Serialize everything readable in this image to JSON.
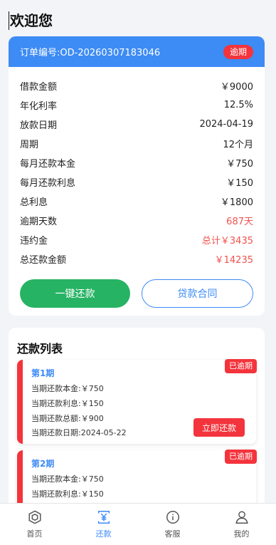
{
  "header": {
    "title": "欢迎您"
  },
  "order": {
    "order_no": "订单编号:OD-20260307183046",
    "status_badge": "逾期",
    "rows": [
      {
        "label": "借款金额",
        "value": "￥9000",
        "red": false
      },
      {
        "label": "年化利率",
        "value": "12.5%",
        "red": false
      },
      {
        "label": "放款日期",
        "value": "2024-04-19",
        "red": false
      },
      {
        "label": "周期",
        "value": "12个月",
        "red": false
      },
      {
        "label": "每月还款本金",
        "value": "￥750",
        "red": false
      },
      {
        "label": "每月还款利息",
        "value": "￥150",
        "red": false
      },
      {
        "label": "总利息",
        "value": "￥1800",
        "red": false
      },
      {
        "label": "逾期天数",
        "value": "687天",
        "red": true
      },
      {
        "label": "违约金",
        "value": "总计￥3435",
        "red": true
      },
      {
        "label": "总还款金额",
        "value": "￥14235",
        "red": true
      }
    ],
    "repay_button": "一键还款",
    "contract_button": "贷款合同"
  },
  "repayment_list": {
    "title": "还款列表",
    "items": [
      {
        "term": "第1期",
        "badge": "已逾期",
        "principal": "当期还款本金:￥750",
        "interest": "当期还款利息:￥150",
        "total": "当期还款总额:￥900",
        "date": "当期还款日期:2024-05-22",
        "pay_button": "立即还款"
      },
      {
        "term": "第2期",
        "badge": "已逾期",
        "principal": "当期还款本金:￥750",
        "interest": "当期还款利息:￥150"
      }
    ]
  },
  "tabbar": {
    "items": [
      {
        "label": "首页",
        "icon": "home-cube-icon",
        "active": false
      },
      {
        "label": "还款",
        "icon": "yen-icon",
        "active": true
      },
      {
        "label": "客服",
        "icon": "info-circle-icon",
        "active": false
      },
      {
        "label": "我的",
        "icon": "user-icon",
        "active": false
      }
    ]
  },
  "colors": {
    "primary": "#3d8bf5",
    "danger": "#f3343c",
    "success": "#27b364"
  }
}
